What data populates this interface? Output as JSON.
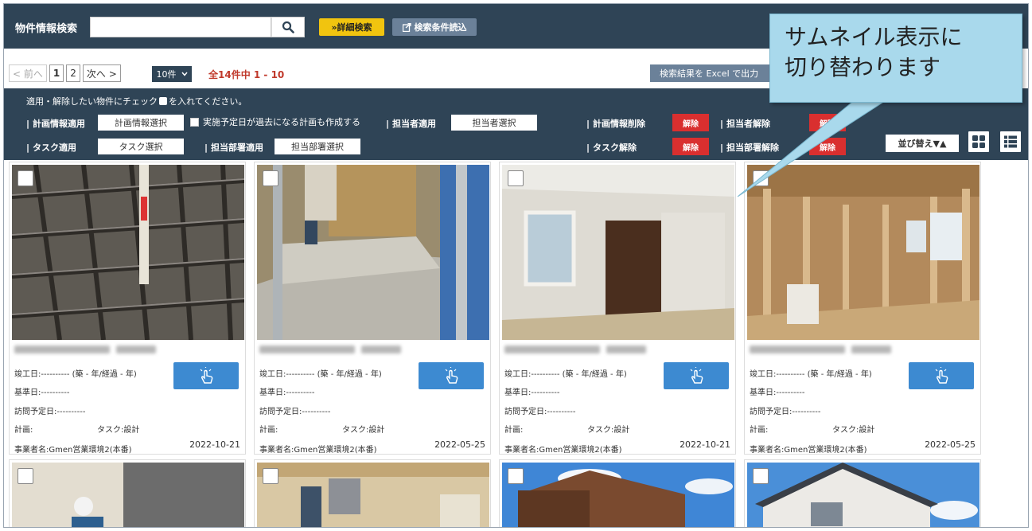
{
  "search": {
    "title": "物件情報検索",
    "value": "",
    "advanced_label": "»詳細検索",
    "load_label": "検索条件読込"
  },
  "pager": {
    "prev": "< 前へ",
    "pages": [
      "1",
      "2"
    ],
    "next": "次へ >",
    "per_page": "10件",
    "count": "全14件中 1 - 10",
    "excel": "検索結果を Excel で出力"
  },
  "panel": {
    "notice_before": "適用・解除したい物件にチェック",
    "notice_after": "を入れてください。",
    "plan_apply": "計画情報適用",
    "plan_select": "計画情報選択",
    "plan_option": "実施予定日が過去になる計画も作成する",
    "person_apply": "担当者適用",
    "person_select": "担当者選択",
    "plan_delete": "計画情報削除",
    "person_release": "担当者解除",
    "task_apply": "タスク適用",
    "task_select": "タスク選択",
    "dept_apply": "担当部署適用",
    "dept_select": "担当部署選択",
    "task_release": "タスク解除",
    "dept_release": "担当部署解除",
    "release": "解除",
    "sort": "並び替え▼▲"
  },
  "cards": [
    {
      "completion": "竣工日:---------- (築 - 年/経過 - 年)",
      "base": "基準日:----------",
      "visit": "訪問予定日:----------",
      "plan": "計画:",
      "task": "タスク:設計",
      "company": "事業者名:Gmen営業環境2(本番)",
      "date": "2022-10-21"
    },
    {
      "completion": "竣工日:---------- (築 - 年/経過 - 年)",
      "base": "基準日:----------",
      "visit": "訪問予定日:----------",
      "plan": "計画:",
      "task": "タスク:設計",
      "company": "事業者名:Gmen営業環境2(本番)",
      "date": "2022-05-25"
    },
    {
      "completion": "竣工日:---------- (築 - 年/経過 - 年)",
      "base": "基準日:----------",
      "visit": "訪問予定日:----------",
      "plan": "計画:",
      "task": "タスク:設計",
      "company": "事業者名:Gmen営業環境2(本番)",
      "date": "2022-10-21"
    },
    {
      "completion": "竣工日:---------- (築 - 年/経過 - 年)",
      "base": "基準日:----------",
      "visit": "訪問予定日:----------",
      "plan": "計画:",
      "task": "タスク:設計",
      "company": "事業者名:Gmen営業環境2(本番)",
      "date": "2022-05-25"
    }
  ],
  "callout": {
    "line1": "サムネイル表示に",
    "line2": "切り替わります"
  },
  "colors": {
    "navy": "#2f4456",
    "accent_yellow": "#f1c40f",
    "danger_red": "#d92f2f",
    "touch_blue": "#3d8ad1",
    "callout": "#a9d9ec"
  },
  "icons": [
    "search-icon",
    "load-icon",
    "chevron-down-icon",
    "touch-icon",
    "grid-view-icon",
    "list-view-icon"
  ]
}
